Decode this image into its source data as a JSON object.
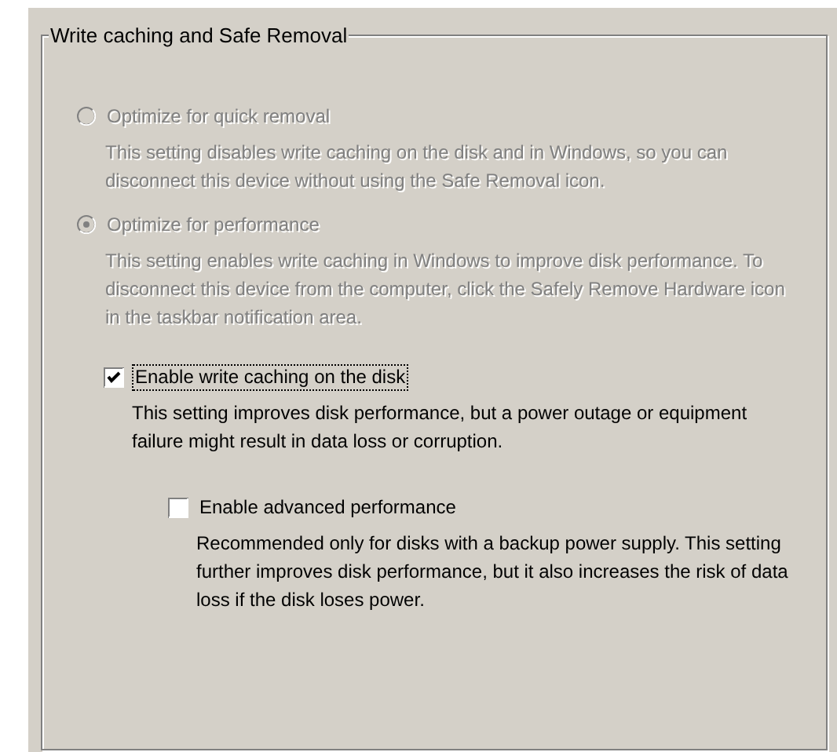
{
  "group": {
    "title": "Write caching and Safe Removal"
  },
  "options": [
    {
      "kind": "radio",
      "label": "Optimize for quick removal",
      "selected": false,
      "disabled": true,
      "description": "This setting disables write caching on the disk and in Windows, so you can disconnect this device without using the Safe Removal icon."
    },
    {
      "kind": "radio",
      "label": "Optimize for performance",
      "selected": true,
      "disabled": true,
      "description": "This setting enables write caching in Windows to improve disk performance. To disconnect this device from the computer, click the Safely Remove Hardware icon in the taskbar notification area.",
      "children": [
        {
          "kind": "checkbox",
          "label": "Enable write caching on the disk",
          "checked": true,
          "disabled": false,
          "focused": true,
          "description": "This setting improves disk performance, but a power outage or equipment failure might result in data loss or corruption.",
          "children": [
            {
              "kind": "checkbox",
              "label": "Enable advanced performance",
              "checked": false,
              "disabled": false,
              "focused": false,
              "description": "Recommended only for disks with a backup power supply. This setting further improves disk performance, but it also increases the risk of data loss if the disk loses power."
            }
          ]
        }
      ]
    }
  ]
}
